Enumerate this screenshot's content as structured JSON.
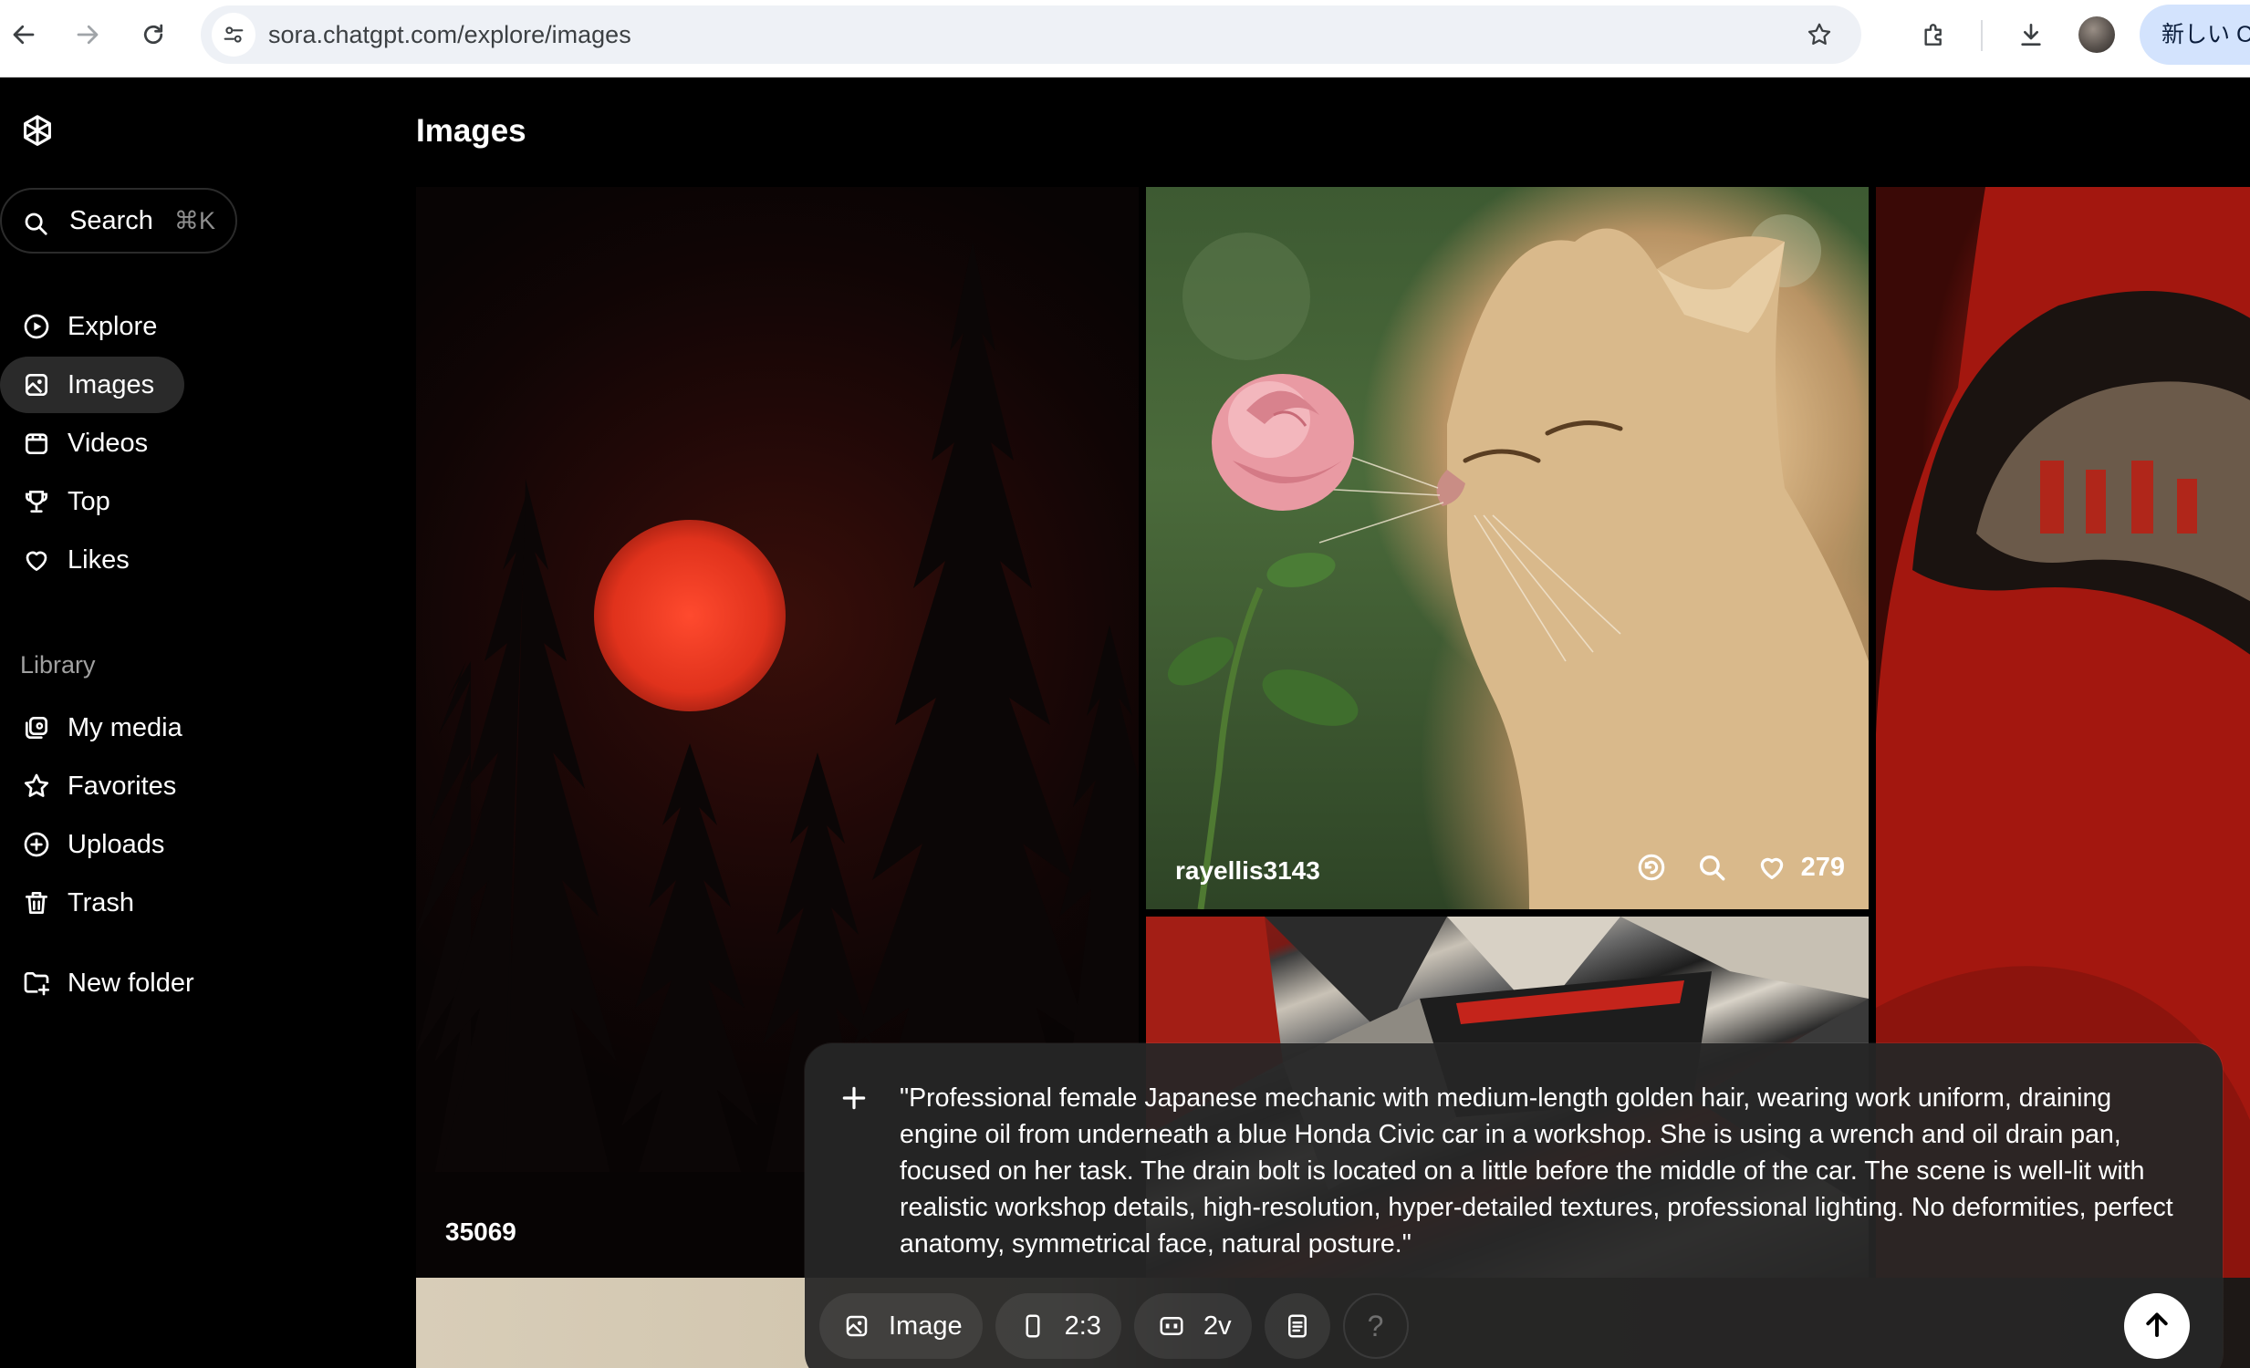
{
  "browser": {
    "url": "sora.chatgpt.com/explore/images",
    "new_chip_label": "新しい C"
  },
  "sidebar": {
    "search_label": "Search",
    "search_shortcut": "⌘K",
    "nav": [
      {
        "label": "Explore",
        "icon": "explore-icon"
      },
      {
        "label": "Images",
        "icon": "image-icon",
        "active": true
      },
      {
        "label": "Videos",
        "icon": "video-icon"
      },
      {
        "label": "Top",
        "icon": "trophy-icon"
      },
      {
        "label": "Likes",
        "icon": "heart-icon"
      }
    ],
    "library_heading": "Library",
    "library": [
      {
        "label": "My media",
        "icon": "media-icon"
      },
      {
        "label": "Favorites",
        "icon": "star-icon"
      },
      {
        "label": "Uploads",
        "icon": "upload-icon"
      },
      {
        "label": "Trash",
        "icon": "trash-icon"
      }
    ],
    "new_folder_label": "New folder"
  },
  "main": {
    "title": "Images",
    "tiles": {
      "forest_label": "35069",
      "cat_author": "rayellis3143",
      "cat_likes": "279"
    }
  },
  "composer": {
    "prompt": "\"Professional female Japanese mechanic with medium-length golden hair, wearing work uniform, draining engine oil from underneath a blue Honda Civic car in a workshop. She is using a wrench and oil drain pan, focused on her task. The drain bolt is located on a little before the middle of the car. The scene is well-lit with realistic workshop details, high-resolution, hyper-detailed textures, professional lighting. No deformities, perfect anatomy, symmetrical face, natural posture.\"",
    "type_label": "Image",
    "aspect_label": "2:3",
    "variations_label": "2v",
    "help_label": "?"
  }
}
